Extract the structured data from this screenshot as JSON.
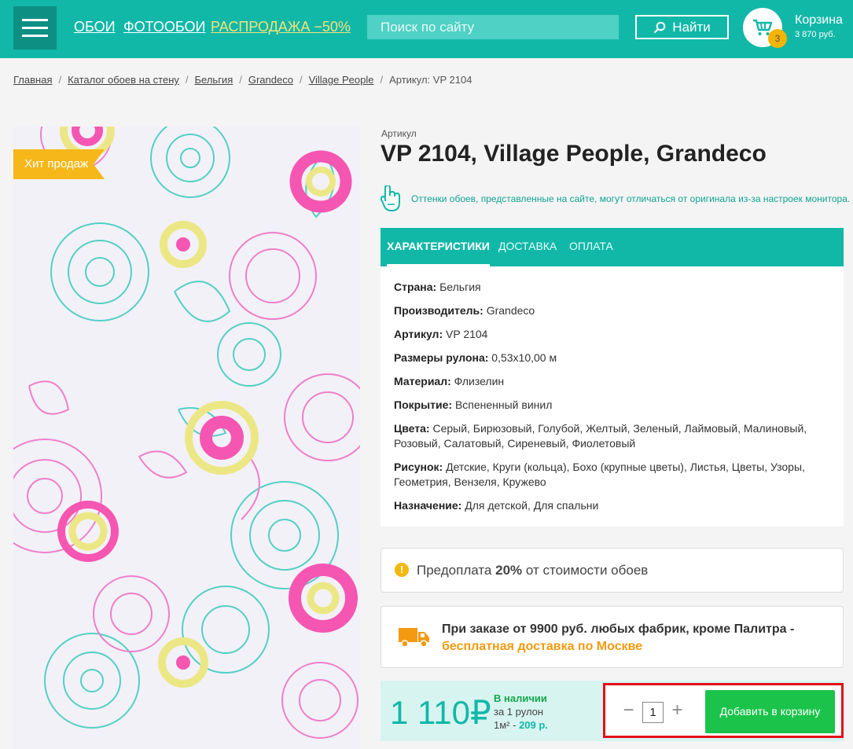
{
  "header": {
    "nav": [
      "ОБОИ",
      "ФОТООБОИ",
      "РАСПРОДАЖА −50%"
    ],
    "search_placeholder": "Поиск по сайту",
    "find_label": "Найти",
    "cart_title": "Корзина",
    "cart_count": "3",
    "cart_sum": "3 870 руб."
  },
  "breadcrumb": {
    "items": [
      "Главная",
      "Каталог обоев на стену",
      "Бельгия",
      "Grandeco",
      "Village People"
    ],
    "current": "Артикул: VP 2104"
  },
  "product": {
    "badge": "Хит продаж",
    "article_label": "Артикул",
    "title": "VP 2104, Village People, Grandeco",
    "notice": "Оттенки обоев, представленные на сайте, могут отличаться от оригинала из-за настроек монитора."
  },
  "tabs": [
    "ХАРАКТЕРИСТИКИ",
    "ДОСТАВКА",
    "ОПЛАТА"
  ],
  "specs": [
    {
      "label": "Страна:",
      "value": "Бельгия"
    },
    {
      "label": "Производитель:",
      "value": "Grandeco"
    },
    {
      "label": "Артикул:",
      "value": "VP 2104"
    },
    {
      "label": "Размеры рулона:",
      "value": "0,53x10,00 м"
    },
    {
      "label": "Материал:",
      "value": "Флизелин"
    },
    {
      "label": "Покрытие:",
      "value": "Вспененный винил"
    },
    {
      "label": "Цвета:",
      "value": "Серый, Бирюзовый, Голубой, Желтый, Зеленый, Лаймовый, Малиновый, Розовый, Салатовый, Сиреневый, Фиолетовый"
    },
    {
      "label": "Рисунок:",
      "value": "Детские, Круги (кольца), Бохо (крупные цветы), Листья, Цветы, Узоры, Геометрия, Вензеля, Кружево"
    },
    {
      "label": "Назначение:",
      "value": "Для детской, Для спальни"
    }
  ],
  "prepay": {
    "before": "Предоплата",
    "percent": "20%",
    "after": "от стоимости обоев"
  },
  "delivery": {
    "line1": "При заказе от 9900 руб. любых фабрик, кроме Палитра -",
    "line2": "бесплатная доставка по Москве"
  },
  "buy": {
    "price": "1 110",
    "currency": "₽",
    "stock": "В наличии",
    "per_roll": "за 1 рулон",
    "per_m2_label": "1м² -",
    "per_m2_value": "209 р.",
    "qty_minus": "−",
    "qty": "1",
    "qty_plus": "+",
    "add_label": "Добавить в корзину"
  },
  "colors": {
    "brand": "#11b8a8",
    "sale": "#f3e37c",
    "add_button": "#1bc34b",
    "highlight": "#e3101a",
    "badge": "#f6b71a"
  }
}
